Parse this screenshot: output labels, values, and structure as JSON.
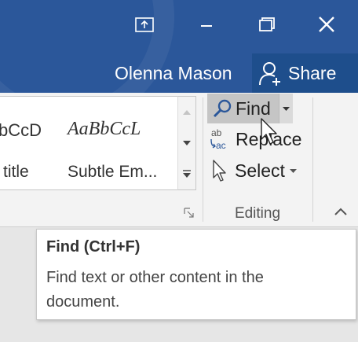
{
  "title_bar": {
    "user_name": "Olenna Mason",
    "share_label": "Share",
    "window_controls": [
      "ribbon-display-options-icon",
      "minimize-icon",
      "restore-icon",
      "close-icon"
    ],
    "accent_color": "#2b579a"
  },
  "styles_gallery": {
    "items": [
      {
        "preview": "bCcD",
        "name": "title"
      },
      {
        "preview": "AaBbCcL",
        "name": "Subtle Em..."
      }
    ]
  },
  "editing_group": {
    "find_label": "Find",
    "replace_label": "Replace",
    "select_label": "Select",
    "group_label": "Editing"
  },
  "tooltip": {
    "title": "Find (Ctrl+F)",
    "description": "Find text or other content in the document."
  }
}
